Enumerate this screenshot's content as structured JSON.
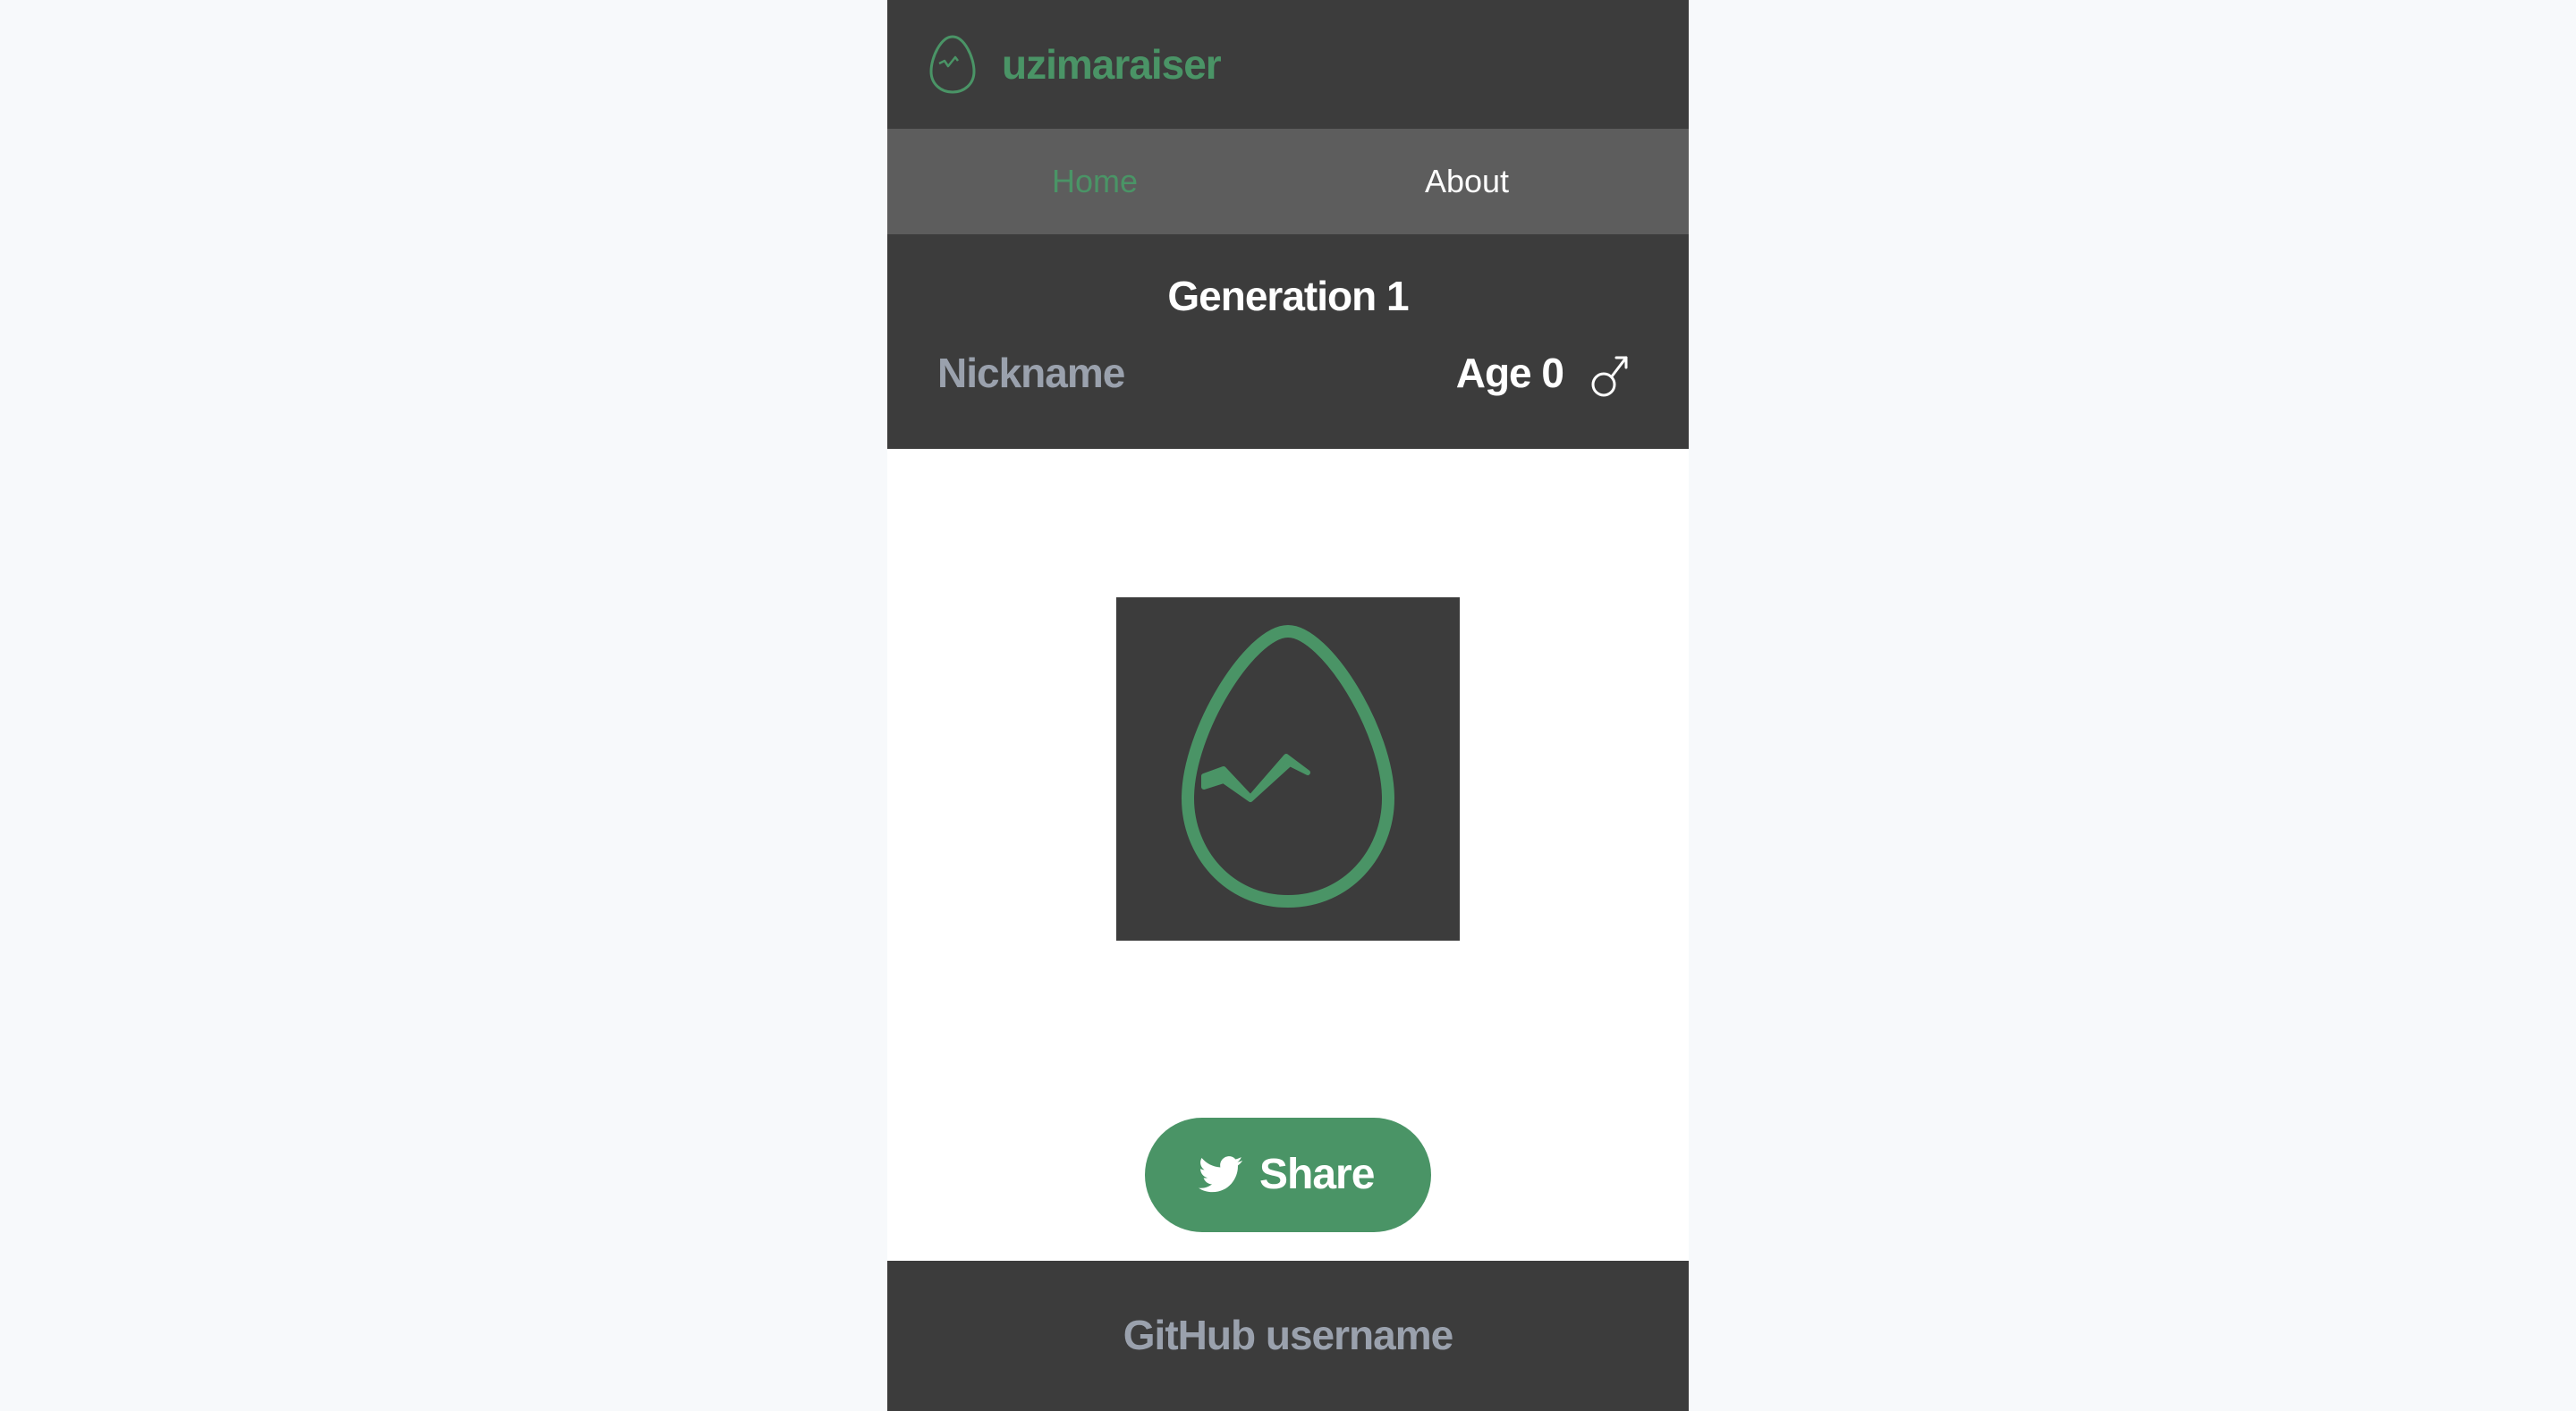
{
  "app": {
    "brand": "uzimaraiser",
    "logo_icon": "egg-icon"
  },
  "nav": {
    "items": [
      {
        "label": "Home",
        "active": true
      },
      {
        "label": "About",
        "active": false
      }
    ]
  },
  "pet": {
    "generation": "Generation 1",
    "nickname_placeholder": "Nickname",
    "age": "Age 0",
    "gender_icon": "male-symbol-icon",
    "image_icon": "cracked-egg-icon"
  },
  "share": {
    "label": "Share",
    "icon": "twitter-bird-icon"
  },
  "footer": {
    "github_placeholder": "GitHub username"
  },
  "colors": {
    "accent": "#4a9466",
    "dark_bg": "#3c3c3c",
    "nav_bg": "#5d5d5d",
    "muted_text": "#9aa1ad",
    "page_bg": "#f7f9fb"
  }
}
